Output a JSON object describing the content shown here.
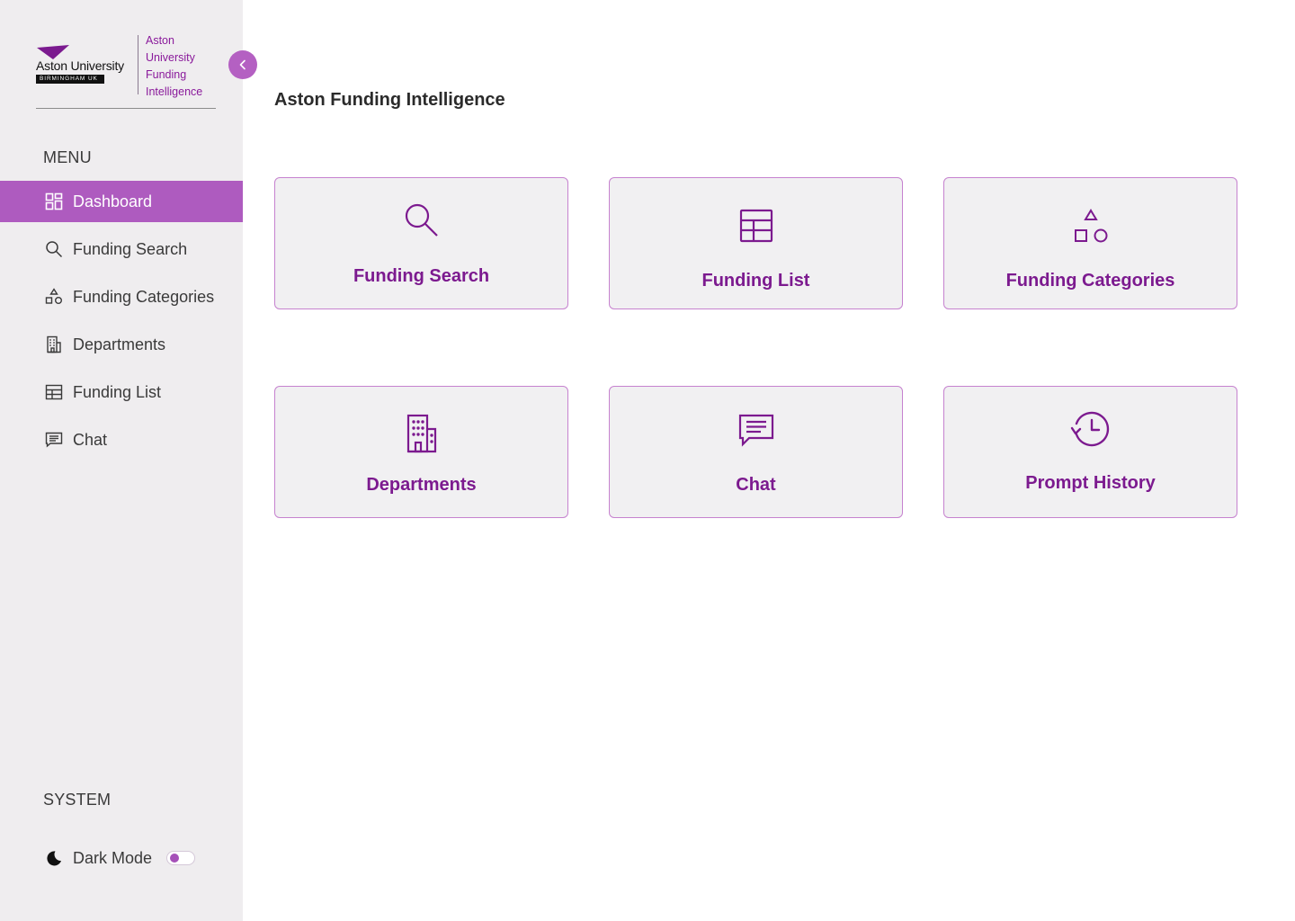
{
  "brand": {
    "logo_name": "Aston University",
    "logo_sub": "BIRMINGHAM UK",
    "title_lines": [
      "Aston",
      "University",
      "Funding",
      "Intelligence"
    ]
  },
  "sidebar": {
    "menu_title": "MENU",
    "items": [
      {
        "label": "Dashboard",
        "icon": "dashboard-grid-icon",
        "active": true
      },
      {
        "label": "Funding Search",
        "icon": "search-icon"
      },
      {
        "label": "Funding Categories",
        "icon": "shapes-icon"
      },
      {
        "label": "Departments",
        "icon": "building-icon"
      },
      {
        "label": "Funding List",
        "icon": "table-icon"
      },
      {
        "label": "Chat",
        "icon": "chat-icon"
      }
    ],
    "system_title": "SYSTEM",
    "dark_mode_label": "Dark Mode",
    "dark_mode_on": false
  },
  "main": {
    "title": "Aston Funding Intelligence",
    "cards": [
      {
        "label": "Funding Search",
        "icon": "search-icon"
      },
      {
        "label": "Funding List",
        "icon": "table-icon"
      },
      {
        "label": "Funding Categories",
        "icon": "shapes-icon"
      },
      {
        "label": "Departments",
        "icon": "building-icon"
      },
      {
        "label": "Chat",
        "icon": "chat-icon"
      },
      {
        "label": "Prompt History",
        "icon": "history-icon"
      }
    ]
  },
  "colors": {
    "accent": "#ae5bbf",
    "accent_dark": "#7c1a8f",
    "sidebar_bg": "#efedef",
    "card_bg": "#f1f0f2",
    "card_border": "#c682cf"
  }
}
